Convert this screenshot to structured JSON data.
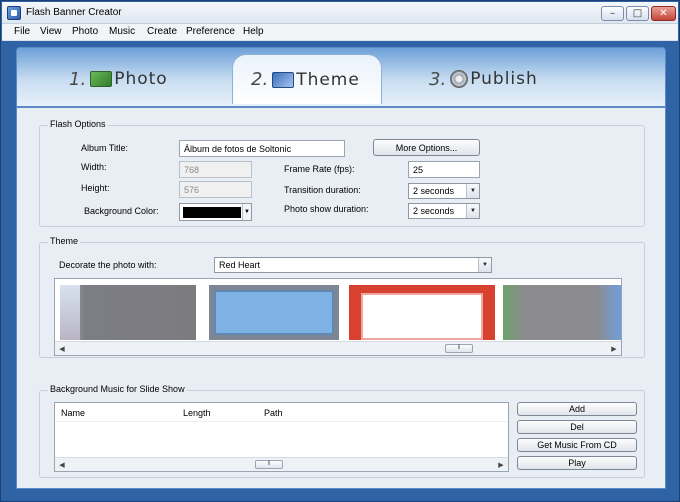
{
  "window": {
    "title": "Flash Banner Creator"
  },
  "menu": [
    "File",
    "View",
    "Photo",
    "Music",
    "Create",
    "Preference",
    "Help"
  ],
  "tabs": [
    {
      "num": "1.",
      "label": "Photo",
      "icon": "photo-icon"
    },
    {
      "num": "2.",
      "label": "Theme",
      "icon": "theme-icon",
      "active": true
    },
    {
      "num": "3.",
      "label": "Publish",
      "icon": "gear-icon"
    }
  ],
  "flash_options": {
    "title": "Flash Options",
    "album_title_label": "Album Title:",
    "album_title_value": "Álbum de fotos de Soltonic",
    "more_options": "More Options...",
    "width_label": "Width:",
    "width_value": "768",
    "height_label": "Height:",
    "height_value": "576",
    "bg_color_label": "Background Color:",
    "bg_color_value": "#000000",
    "frame_rate_label": "Frame Rate (fps):",
    "frame_rate_value": "25",
    "transition_label": "Transition duration:",
    "transition_value": "2 seconds",
    "photo_show_label": "Photo show duration:",
    "photo_show_value": "2 seconds"
  },
  "theme": {
    "title": "Theme",
    "decorate_label": "Decorate the photo with:",
    "decorate_value": "Red Heart",
    "scroll_grip": "⦀"
  },
  "music": {
    "title": "Background Music for Slide Show",
    "columns": [
      "Name",
      "Length",
      "Path"
    ],
    "buttons": {
      "add": "Add",
      "del": "Del",
      "get_cd": "Get Music From CD",
      "play": "Play"
    },
    "scroll_grip": "⦀"
  },
  "window_buttons": {
    "min": "–",
    "max": "□",
    "close": "✕"
  },
  "colors": {
    "frame": "#2e63a6",
    "panel": "#e9eef5",
    "close": "#c4453a"
  }
}
